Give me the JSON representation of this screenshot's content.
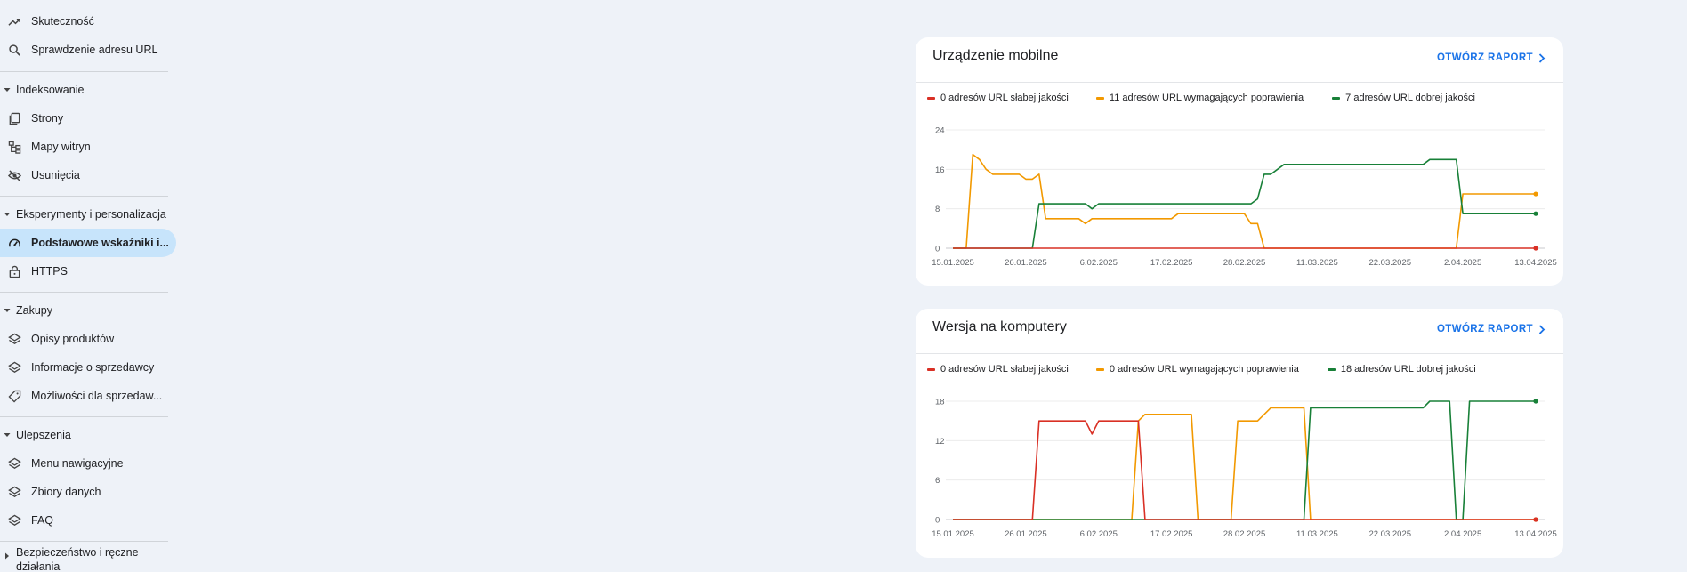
{
  "sidebar": {
    "top_items": [
      {
        "label": "Skuteczność",
        "icon": "trending-up-icon"
      },
      {
        "label": "Sprawdzenie adresu URL",
        "icon": "search-icon"
      }
    ],
    "sections": [
      {
        "title": "Indeksowanie",
        "items": [
          {
            "label": "Strony",
            "icon": "pages-icon"
          },
          {
            "label": "Mapy witryn",
            "icon": "sitemap-icon"
          },
          {
            "label": "Usunięcia",
            "icon": "eye-off-icon"
          }
        ]
      },
      {
        "title": "Eksperymenty i personalizacja",
        "items": [
          {
            "label": "Podstawowe wskaźniki i...",
            "icon": "speed-icon",
            "active": true
          },
          {
            "label": "HTTPS",
            "icon": "lock-icon"
          }
        ]
      },
      {
        "title": "Zakupy",
        "items": [
          {
            "label": "Opisy produktów",
            "icon": "layers-icon"
          },
          {
            "label": "Informacje o sprzedawcy",
            "icon": "layers-icon"
          },
          {
            "label": "Możliwości dla sprzedaw...",
            "icon": "tag-icon"
          }
        ]
      },
      {
        "title": "Ulepszenia",
        "items": [
          {
            "label": "Menu nawigacyjne",
            "icon": "layers-icon"
          },
          {
            "label": "Zbiory danych",
            "icon": "layers-icon"
          },
          {
            "label": "FAQ",
            "icon": "layers-icon"
          }
        ]
      }
    ],
    "collapsed_section": {
      "title_line1": "Bezpieczeństwo i ręczne",
      "title_line2": "działania"
    }
  },
  "colors": {
    "poor": "#d93025",
    "needs": "#f29900",
    "good": "#188038",
    "link": "#1a73e8"
  },
  "cards": [
    {
      "title": "Urządzenie mobilne",
      "link": "OTWÓRZ RAPORT",
      "legend": [
        "0 adresów URL słabej jakości",
        "11 adresów URL wymagających poprawienia",
        "7 adresów URL dobrej jakości"
      ]
    },
    {
      "title": "Wersja na komputery",
      "link": "OTWÓRZ RAPORT",
      "legend": [
        "0 adresów URL słabej jakości",
        "0 adresów URL wymagających poprawienia",
        "18 adresów URL dobrej jakości"
      ]
    }
  ],
  "chart_data": [
    {
      "type": "line",
      "title": "Urządzenie mobilne",
      "x_start": "15.01.2025",
      "x_end": "13.04.2025",
      "xticks": [
        "15.01.2025",
        "26.01.2025",
        "6.02.2025",
        "17.02.2025",
        "28.02.2025",
        "11.03.2025",
        "22.03.2025",
        "2.04.2025",
        "13.04.2025"
      ],
      "ylim": [
        0,
        24
      ],
      "yticks": [
        0,
        8,
        16,
        24
      ],
      "series": [
        {
          "name": "0 adresów URL słabej jakości",
          "color": "#d93025",
          "points": [
            [
              "15.01.2025",
              0
            ],
            [
              "13.04.2025",
              0
            ]
          ]
        },
        {
          "name": "11 adresów URL wymagających poprawienia",
          "color": "#f29900",
          "points": [
            [
              "15.01.2025",
              0
            ],
            [
              "17.01.2025",
              0
            ],
            [
              "18.01.2025",
              19
            ],
            [
              "19.01.2025",
              18
            ],
            [
              "20.01.2025",
              16
            ],
            [
              "21.01.2025",
              15
            ],
            [
              "25.01.2025",
              15
            ],
            [
              "26.01.2025",
              14
            ],
            [
              "27.01.2025",
              14
            ],
            [
              "28.01.2025",
              15
            ],
            [
              "29.01.2025",
              6
            ],
            [
              "3.02.2025",
              6
            ],
            [
              "4.02.2025",
              5
            ],
            [
              "5.02.2025",
              6
            ],
            [
              "17.02.2025",
              6
            ],
            [
              "18.02.2025",
              7
            ],
            [
              "28.02.2025",
              7
            ],
            [
              "1.03.2025",
              5
            ],
            [
              "2.03.2025",
              5
            ],
            [
              "3.03.2025",
              0
            ],
            [
              "1.04.2025",
              0
            ],
            [
              "2.04.2025",
              11
            ],
            [
              "13.04.2025",
              11
            ]
          ]
        },
        {
          "name": "7 adresów URL dobrej jakości",
          "color": "#188038",
          "points": [
            [
              "15.01.2025",
              0
            ],
            [
              "27.01.2025",
              0
            ],
            [
              "28.01.2025",
              9
            ],
            [
              "4.02.2025",
              9
            ],
            [
              "5.02.2025",
              8
            ],
            [
              "6.02.2025",
              9
            ],
            [
              "1.03.2025",
              9
            ],
            [
              "2.03.2025",
              10
            ],
            [
              "3.03.2025",
              15
            ],
            [
              "4.03.2025",
              15
            ],
            [
              "6.03.2025",
              17
            ],
            [
              "27.03.2025",
              17
            ],
            [
              "28.03.2025",
              18
            ],
            [
              "1.04.2025",
              18
            ],
            [
              "2.04.2025",
              7
            ],
            [
              "13.04.2025",
              7
            ]
          ]
        }
      ]
    },
    {
      "type": "line",
      "title": "Wersja na komputery",
      "x_start": "15.01.2025",
      "x_end": "13.04.2025",
      "xticks": [
        "15.01.2025",
        "26.01.2025",
        "6.02.2025",
        "17.02.2025",
        "28.02.2025",
        "11.03.2025",
        "22.03.2025",
        "2.04.2025",
        "13.04.2025"
      ],
      "ylim": [
        0,
        18
      ],
      "yticks": [
        0,
        6,
        12,
        18
      ],
      "series": [
        {
          "name": "0 adresów URL słabej jakości",
          "color": "#d93025",
          "points": [
            [
              "15.01.2025",
              0
            ],
            [
              "27.01.2025",
              0
            ],
            [
              "28.01.2025",
              15
            ],
            [
              "4.02.2025",
              15
            ],
            [
              "5.02.2025",
              13
            ],
            [
              "6.02.2025",
              15
            ],
            [
              "12.02.2025",
              15
            ],
            [
              "13.02.2025",
              0
            ],
            [
              "13.04.2025",
              0
            ]
          ]
        },
        {
          "name": "0 adresów URL wymagających poprawienia",
          "color": "#f29900",
          "points": [
            [
              "15.01.2025",
              0
            ],
            [
              "11.02.2025",
              0
            ],
            [
              "12.02.2025",
              15
            ],
            [
              "13.02.2025",
              16
            ],
            [
              "20.02.2025",
              16
            ],
            [
              "21.02.2025",
              0
            ],
            [
              "26.02.2025",
              0
            ],
            [
              "27.02.2025",
              15
            ],
            [
              "2.03.2025",
              15
            ],
            [
              "4.03.2025",
              17
            ],
            [
              "9.03.2025",
              17
            ],
            [
              "10.03.2025",
              0
            ],
            [
              "13.04.2025",
              0
            ]
          ]
        },
        {
          "name": "18 adresów URL dobrej jakości",
          "color": "#188038",
          "points": [
            [
              "15.01.2025",
              0
            ],
            [
              "9.03.2025",
              0
            ],
            [
              "10.03.2025",
              17
            ],
            [
              "27.03.2025",
              17
            ],
            [
              "28.03.2025",
              18
            ],
            [
              "31.03.2025",
              18
            ],
            [
              "1.04.2025",
              0
            ],
            [
              "2.04.2025",
              0
            ],
            [
              "3.04.2025",
              18
            ],
            [
              "13.04.2025",
              18
            ]
          ]
        }
      ]
    }
  ]
}
